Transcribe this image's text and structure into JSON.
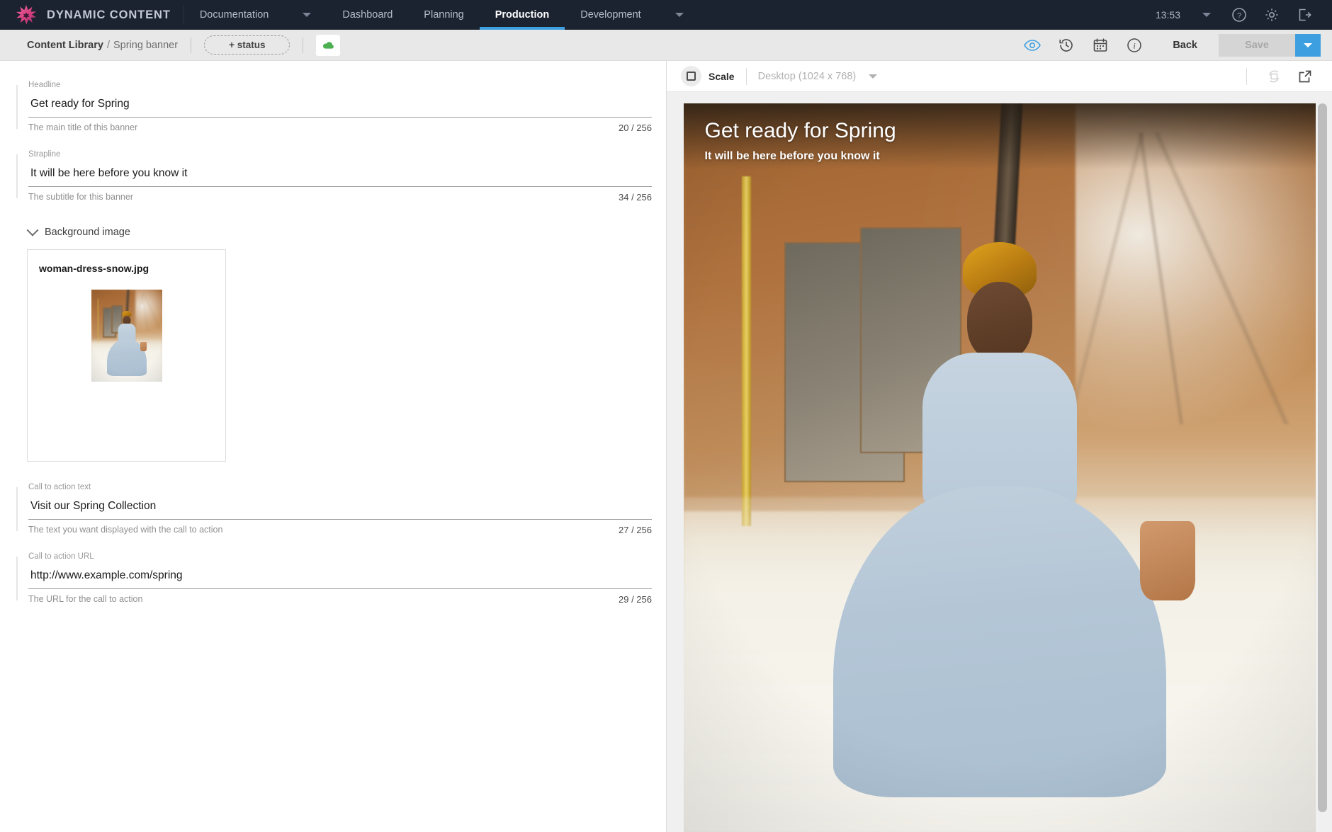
{
  "topnav": {
    "brand": "DYNAMIC CONTENT",
    "logo_icon": "starburst-logo-icon",
    "items": [
      {
        "label": "Documentation",
        "active": false,
        "has_caret": true
      },
      {
        "label": "Dashboard",
        "active": false,
        "has_caret": false
      },
      {
        "label": "Planning",
        "active": false,
        "has_caret": false
      },
      {
        "label": "Production",
        "active": true,
        "has_caret": false
      },
      {
        "label": "Development",
        "active": false,
        "has_caret": true
      }
    ],
    "clock": "13:53",
    "icons": [
      "chevron-down-icon",
      "help-icon",
      "gear-icon",
      "logout-icon"
    ],
    "accent_color": "#3e9fe0",
    "background_color": "#1b2230"
  },
  "breadcrumb": {
    "root": "Content Library",
    "separator": "/",
    "leaf": "Spring banner",
    "status_button": "+ status",
    "cloud_icon": "cloud-publish-icon",
    "cloud_color": "#4caf50",
    "actions": {
      "preview_icon": "eye-icon",
      "history_icon": "history-clock-icon",
      "schedule_icon": "calendar-icon",
      "info_icon": "info-icon",
      "back": "Back",
      "save": "Save",
      "save_dropdown_icon": "chevron-down-icon"
    }
  },
  "form": {
    "fields": [
      {
        "label": "Headline",
        "value": "Get ready for Spring",
        "hint": "The main title of this banner",
        "count": "20 / 256"
      },
      {
        "label": "Strapline",
        "value": "It will be here before you know it",
        "hint": "The subtitle for this banner",
        "count": "34 / 256"
      }
    ],
    "background_image": {
      "section_title": "Background image",
      "chevron_icon": "chevron-down-icon",
      "file_name": "woman-dress-snow.jpg"
    },
    "cta_fields": [
      {
        "label": "Call to action text",
        "value": "Visit our Spring Collection",
        "hint": "The text you want displayed with the call to action",
        "count": "27 / 256"
      },
      {
        "label": "Call to action URL",
        "value": "http://www.example.com/spring",
        "hint": "The URL for the call to action",
        "count": "29 / 256"
      }
    ]
  },
  "preview": {
    "scale_label": "Scale",
    "scale_checked": false,
    "device": "Desktop (1024 x 768)",
    "device_caret_icon": "chevron-down-icon",
    "refresh_icon": "rotate-refresh-icon",
    "open_external_icon": "external-link-icon",
    "banner": {
      "headline": "Get ready for Spring",
      "strapline": "It will be here before you know it"
    }
  }
}
